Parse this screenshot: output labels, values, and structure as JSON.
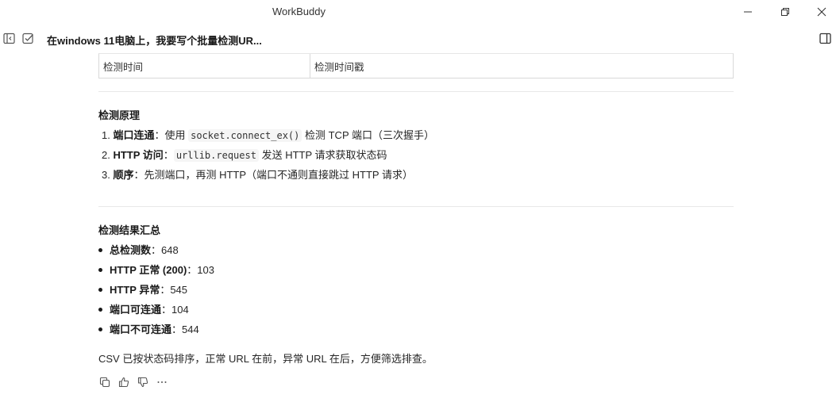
{
  "window": {
    "title": "WorkBuddy"
  },
  "header": {
    "conversation_title": "在windows 11电脑上，我要写个批量检测UR..."
  },
  "table": {
    "row": [
      "检测时间",
      "检测时间戳"
    ]
  },
  "principle": {
    "title": "检测原理",
    "items": [
      {
        "num": "1.",
        "label": "端口连通",
        "sep": "：使用 ",
        "code": "socket.connect_ex()",
        "rest": " 检测 TCP 端口（三次握手）"
      },
      {
        "num": "2.",
        "label": "HTTP 访问",
        "sep": "：",
        "code": "urllib.request",
        "rest": " 发送 HTTP 请求获取状态码"
      },
      {
        "num": "3.",
        "label": "顺序",
        "sep": "：先测端口，再测 HTTP（端口不通则直接跳过 HTTP 请求）",
        "code": "",
        "rest": ""
      }
    ]
  },
  "summary": {
    "title": "检测结果汇总",
    "items": [
      {
        "label": "总检测数",
        "value": "：648"
      },
      {
        "label": "HTTP 正常 (200)",
        "value": "：103"
      },
      {
        "label": "HTTP 异常",
        "value": "：545"
      },
      {
        "label": "端口可连通",
        "value": "：104"
      },
      {
        "label": "端口不可连通",
        "value": "：544"
      }
    ],
    "note": "CSV 已按状态码排序，正常 URL 在前，异常 URL 在后，方便筛选排查。"
  },
  "icons": {
    "sidebar_toggle": "sidebar-toggle-icon",
    "checkbox": "checkbox-icon",
    "panel": "panel-icon",
    "copy": "copy-icon",
    "thumbs_up": "thumbs-up-icon",
    "thumbs_down": "thumbs-down-icon",
    "more": "more-icon"
  }
}
